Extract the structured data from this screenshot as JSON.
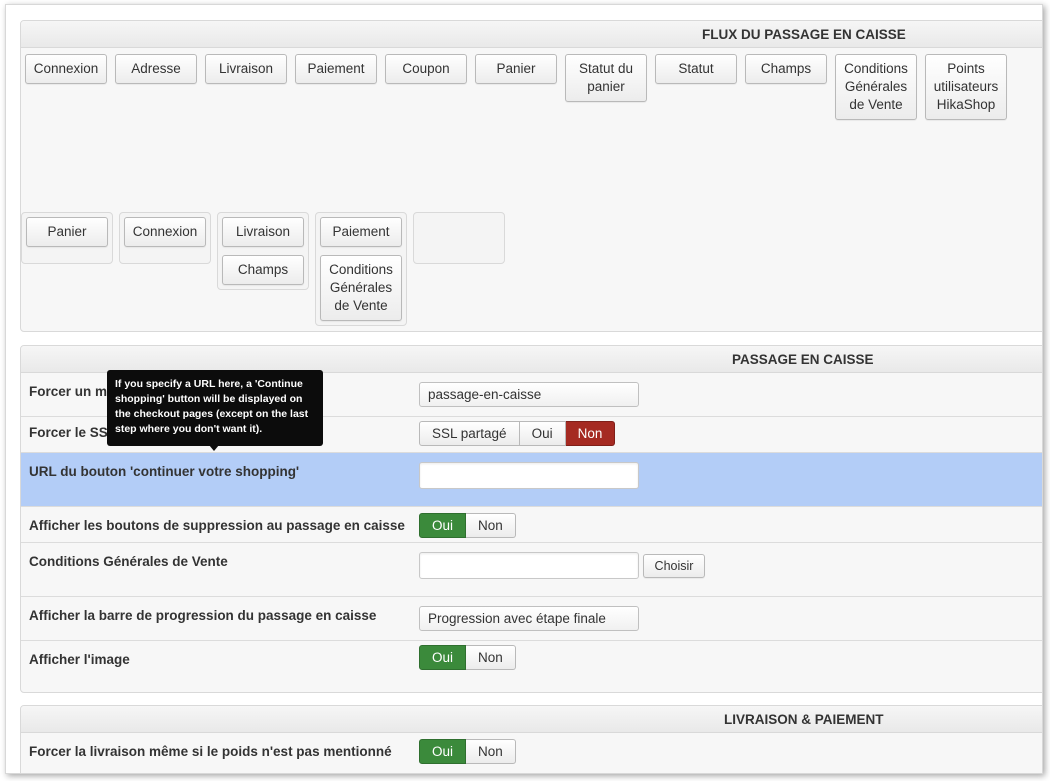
{
  "flow": {
    "title": "FLUX DU PASSAGE EN CAISSE",
    "available_blocks": [
      "Connexion",
      "Adresse",
      "Livraison",
      "Paiement",
      "Coupon",
      "Panier",
      "Statut du panier",
      "Statut",
      "Champs",
      "Conditions Générales de Vente",
      "Points utilisateurs HikaShop"
    ],
    "steps": [
      {
        "blocks": [
          "Panier"
        ]
      },
      {
        "blocks": [
          "Connexion"
        ]
      },
      {
        "blocks": [
          "Livraison",
          "Champs"
        ]
      },
      {
        "blocks": [
          "Paiement",
          "Conditions Générales de Vente"
        ]
      },
      {
        "blocks": []
      }
    ]
  },
  "checkout": {
    "title": "PASSAGE EN CAISSE",
    "rows": {
      "force_menu": {
        "label": "Forcer un menu",
        "value": "passage-en-caisse"
      },
      "force_ssl": {
        "label": "Forcer le SSL",
        "options": [
          "SSL partagé",
          "Oui",
          "Non"
        ],
        "selected": "Non"
      },
      "continue_url": {
        "label": "URL du bouton 'continuer votre shopping'",
        "value": ""
      },
      "show_delete": {
        "label": "Afficher les boutons de suppression au passage en caisse",
        "options": [
          "Oui",
          "Non"
        ],
        "selected": "Oui"
      },
      "terms": {
        "label": "Conditions Générales de Vente",
        "value": "",
        "button": "Choisir"
      },
      "progress_bar": {
        "label": "Afficher la barre de progression du passage en caisse",
        "value": "Progression avec étape finale"
      },
      "show_image": {
        "label": "Afficher l'image",
        "options": [
          "Oui",
          "Non"
        ],
        "selected": "Oui"
      }
    }
  },
  "shipping": {
    "title": "LIVRAISON & PAIEMENT",
    "rows": {
      "force_shipping": {
        "label": "Forcer la livraison même si le poids n'est pas mentionné",
        "options": [
          "Oui",
          "Non"
        ],
        "selected": "Oui"
      }
    }
  },
  "tooltip": {
    "text": "If you specify a URL here, a 'Continue shopping' button will be displayed on the checkout pages (except on the last step where you don't want it)."
  },
  "colors": {
    "selected_yes": "#3b8a3b",
    "selected_no": "#a52a22",
    "highlight_row": "#b3cdf7"
  }
}
